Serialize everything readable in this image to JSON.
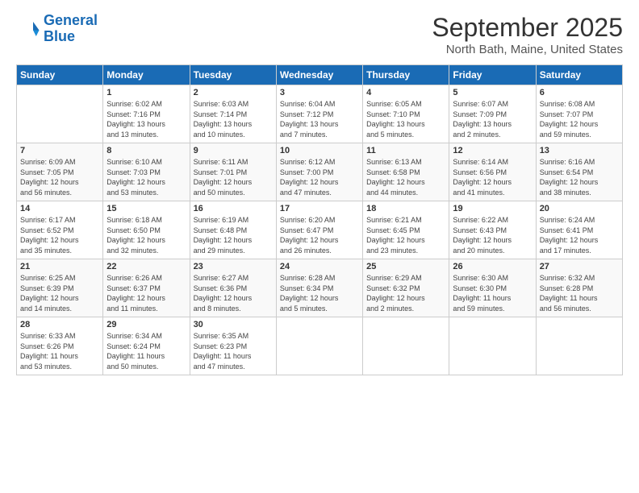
{
  "header": {
    "logo_line1": "General",
    "logo_line2": "Blue",
    "main_title": "September 2025",
    "sub_title": "North Bath, Maine, United States"
  },
  "days_header": [
    "Sunday",
    "Monday",
    "Tuesday",
    "Wednesday",
    "Thursday",
    "Friday",
    "Saturday"
  ],
  "weeks": [
    [
      {
        "num": "",
        "info": ""
      },
      {
        "num": "1",
        "info": "Sunrise: 6:02 AM\nSunset: 7:16 PM\nDaylight: 13 hours\nand 13 minutes."
      },
      {
        "num": "2",
        "info": "Sunrise: 6:03 AM\nSunset: 7:14 PM\nDaylight: 13 hours\nand 10 minutes."
      },
      {
        "num": "3",
        "info": "Sunrise: 6:04 AM\nSunset: 7:12 PM\nDaylight: 13 hours\nand 7 minutes."
      },
      {
        "num": "4",
        "info": "Sunrise: 6:05 AM\nSunset: 7:10 PM\nDaylight: 13 hours\nand 5 minutes."
      },
      {
        "num": "5",
        "info": "Sunrise: 6:07 AM\nSunset: 7:09 PM\nDaylight: 13 hours\nand 2 minutes."
      },
      {
        "num": "6",
        "info": "Sunrise: 6:08 AM\nSunset: 7:07 PM\nDaylight: 12 hours\nand 59 minutes."
      }
    ],
    [
      {
        "num": "7",
        "info": "Sunrise: 6:09 AM\nSunset: 7:05 PM\nDaylight: 12 hours\nand 56 minutes."
      },
      {
        "num": "8",
        "info": "Sunrise: 6:10 AM\nSunset: 7:03 PM\nDaylight: 12 hours\nand 53 minutes."
      },
      {
        "num": "9",
        "info": "Sunrise: 6:11 AM\nSunset: 7:01 PM\nDaylight: 12 hours\nand 50 minutes."
      },
      {
        "num": "10",
        "info": "Sunrise: 6:12 AM\nSunset: 7:00 PM\nDaylight: 12 hours\nand 47 minutes."
      },
      {
        "num": "11",
        "info": "Sunrise: 6:13 AM\nSunset: 6:58 PM\nDaylight: 12 hours\nand 44 minutes."
      },
      {
        "num": "12",
        "info": "Sunrise: 6:14 AM\nSunset: 6:56 PM\nDaylight: 12 hours\nand 41 minutes."
      },
      {
        "num": "13",
        "info": "Sunrise: 6:16 AM\nSunset: 6:54 PM\nDaylight: 12 hours\nand 38 minutes."
      }
    ],
    [
      {
        "num": "14",
        "info": "Sunrise: 6:17 AM\nSunset: 6:52 PM\nDaylight: 12 hours\nand 35 minutes."
      },
      {
        "num": "15",
        "info": "Sunrise: 6:18 AM\nSunset: 6:50 PM\nDaylight: 12 hours\nand 32 minutes."
      },
      {
        "num": "16",
        "info": "Sunrise: 6:19 AM\nSunset: 6:48 PM\nDaylight: 12 hours\nand 29 minutes."
      },
      {
        "num": "17",
        "info": "Sunrise: 6:20 AM\nSunset: 6:47 PM\nDaylight: 12 hours\nand 26 minutes."
      },
      {
        "num": "18",
        "info": "Sunrise: 6:21 AM\nSunset: 6:45 PM\nDaylight: 12 hours\nand 23 minutes."
      },
      {
        "num": "19",
        "info": "Sunrise: 6:22 AM\nSunset: 6:43 PM\nDaylight: 12 hours\nand 20 minutes."
      },
      {
        "num": "20",
        "info": "Sunrise: 6:24 AM\nSunset: 6:41 PM\nDaylight: 12 hours\nand 17 minutes."
      }
    ],
    [
      {
        "num": "21",
        "info": "Sunrise: 6:25 AM\nSunset: 6:39 PM\nDaylight: 12 hours\nand 14 minutes."
      },
      {
        "num": "22",
        "info": "Sunrise: 6:26 AM\nSunset: 6:37 PM\nDaylight: 12 hours\nand 11 minutes."
      },
      {
        "num": "23",
        "info": "Sunrise: 6:27 AM\nSunset: 6:36 PM\nDaylight: 12 hours\nand 8 minutes."
      },
      {
        "num": "24",
        "info": "Sunrise: 6:28 AM\nSunset: 6:34 PM\nDaylight: 12 hours\nand 5 minutes."
      },
      {
        "num": "25",
        "info": "Sunrise: 6:29 AM\nSunset: 6:32 PM\nDaylight: 12 hours\nand 2 minutes."
      },
      {
        "num": "26",
        "info": "Sunrise: 6:30 AM\nSunset: 6:30 PM\nDaylight: 11 hours\nand 59 minutes."
      },
      {
        "num": "27",
        "info": "Sunrise: 6:32 AM\nSunset: 6:28 PM\nDaylight: 11 hours\nand 56 minutes."
      }
    ],
    [
      {
        "num": "28",
        "info": "Sunrise: 6:33 AM\nSunset: 6:26 PM\nDaylight: 11 hours\nand 53 minutes."
      },
      {
        "num": "29",
        "info": "Sunrise: 6:34 AM\nSunset: 6:24 PM\nDaylight: 11 hours\nand 50 minutes."
      },
      {
        "num": "30",
        "info": "Sunrise: 6:35 AM\nSunset: 6:23 PM\nDaylight: 11 hours\nand 47 minutes."
      },
      {
        "num": "",
        "info": ""
      },
      {
        "num": "",
        "info": ""
      },
      {
        "num": "",
        "info": ""
      },
      {
        "num": "",
        "info": ""
      }
    ]
  ]
}
